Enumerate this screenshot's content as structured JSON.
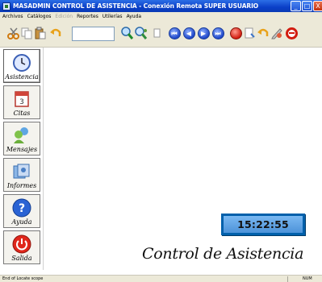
{
  "window": {
    "title": "MASADMIN CONTROL DE ASISTENCIA - Conexión Remota  SUPER USUARIO",
    "minimize_glyph": "_",
    "maximize_glyph": "□",
    "close_glyph": "X"
  },
  "menu": {
    "items": [
      {
        "label": "Archivos",
        "enabled": true
      },
      {
        "label": "Catálogos",
        "enabled": true
      },
      {
        "label": "Edición",
        "enabled": false
      },
      {
        "label": "Reportes",
        "enabled": true
      },
      {
        "label": "Utilerías",
        "enabled": true
      },
      {
        "label": "Ayuda",
        "enabled": true
      }
    ]
  },
  "toolbar": {
    "search_value": "",
    "icons": [
      "cut-icon",
      "copy-icon",
      "paste-icon",
      "undo-icon",
      "search-icon",
      "find-person-icon",
      "blank-icon",
      "first-record-icon",
      "previous-record-icon",
      "next-record-icon",
      "last-record-icon",
      "new-record-icon",
      "delete-icon",
      "undo-edit-icon",
      "edit-icon",
      "stop-icon"
    ],
    "nav_glyphs": [
      "⏮",
      "◀",
      "▶",
      "⏭"
    ]
  },
  "sidebar": {
    "items": [
      {
        "label": "Asistencia",
        "icon": "clock-icon",
        "active": true
      },
      {
        "label": "Citas",
        "icon": "calendar-icon",
        "active": false
      },
      {
        "label": "Mensajes",
        "icon": "users-icon",
        "active": false
      },
      {
        "label": "Informes",
        "icon": "reports-icon",
        "active": false
      },
      {
        "label": "Ayuda",
        "icon": "help-icon",
        "active": false
      },
      {
        "label": "Salida",
        "icon": "power-icon",
        "active": false
      }
    ]
  },
  "main": {
    "clock": "15:22:55",
    "app_name": "Control de Asistencia"
  },
  "status": {
    "text": "End of Locate scope",
    "num": "NUM"
  },
  "colors": {
    "titlebar": "#0a3fc7",
    "chrome": "#ece9d8",
    "clock_frame": "#0060ab",
    "clock_face": "#6aaae9"
  }
}
